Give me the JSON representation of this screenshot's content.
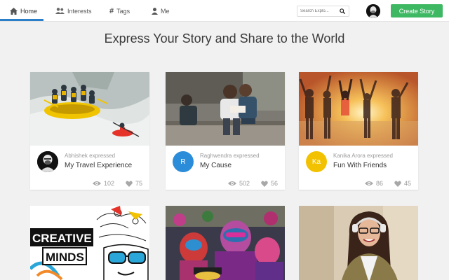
{
  "nav": {
    "tabs": [
      {
        "label": "Home",
        "icon": "home-icon"
      },
      {
        "label": "Interests",
        "icon": "users-icon"
      },
      {
        "label": "Tags",
        "icon": "hash-icon"
      },
      {
        "label": "Me",
        "icon": "user-icon"
      }
    ],
    "search_placeholder": "Search Explo...",
    "create_label": "Create Story"
  },
  "headline": "Express Your Story and Share to the World",
  "stories": [
    {
      "author": "Abhishek",
      "verb": "expressed",
      "title": "My Travel Experience",
      "views": "102",
      "likes": "75",
      "avatar_initials": "",
      "avatar_color": "#111111"
    },
    {
      "author": "Raghwendra",
      "verb": "expressed",
      "title": "My Cause",
      "views": "502",
      "likes": "56",
      "avatar_initials": "R",
      "avatar_color": "#2b8cd9"
    },
    {
      "author": "Kanika Arora",
      "verb": "expressed",
      "title": "Fun With Friends",
      "views": "86",
      "likes": "45",
      "avatar_initials": "Ka",
      "avatar_color": "#f2c200"
    }
  ],
  "second_row_images": [
    "creative-minds-illustration",
    "holi-festival-photo",
    "woman-with-headphones-photo"
  ],
  "creative_minds_text": [
    "CREATIVE",
    "MINDS"
  ],
  "colors": {
    "accent": "#2b7fc8",
    "create_button": "#3fb863",
    "background": "#f1f1f1"
  }
}
